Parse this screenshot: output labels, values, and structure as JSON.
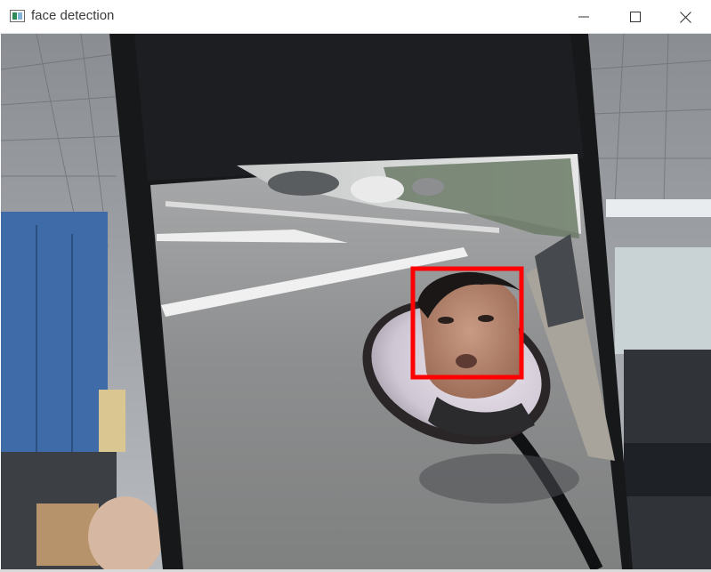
{
  "window": {
    "title": "face detection",
    "icon": "opencv-window-icon",
    "controls": {
      "minimize_icon": "minimize-icon",
      "maximize_icon": "maximize-icon",
      "close_icon": "close-icon"
    }
  },
  "viewport": {
    "content": "camera-frame",
    "detections": [
      {
        "label_icon": "face-box",
        "color": "#ff0000"
      }
    ]
  },
  "colors": {
    "detection_box": "#ff0000",
    "titlebar_bg": "#ffffff",
    "title_text": "#3b3b3b"
  }
}
